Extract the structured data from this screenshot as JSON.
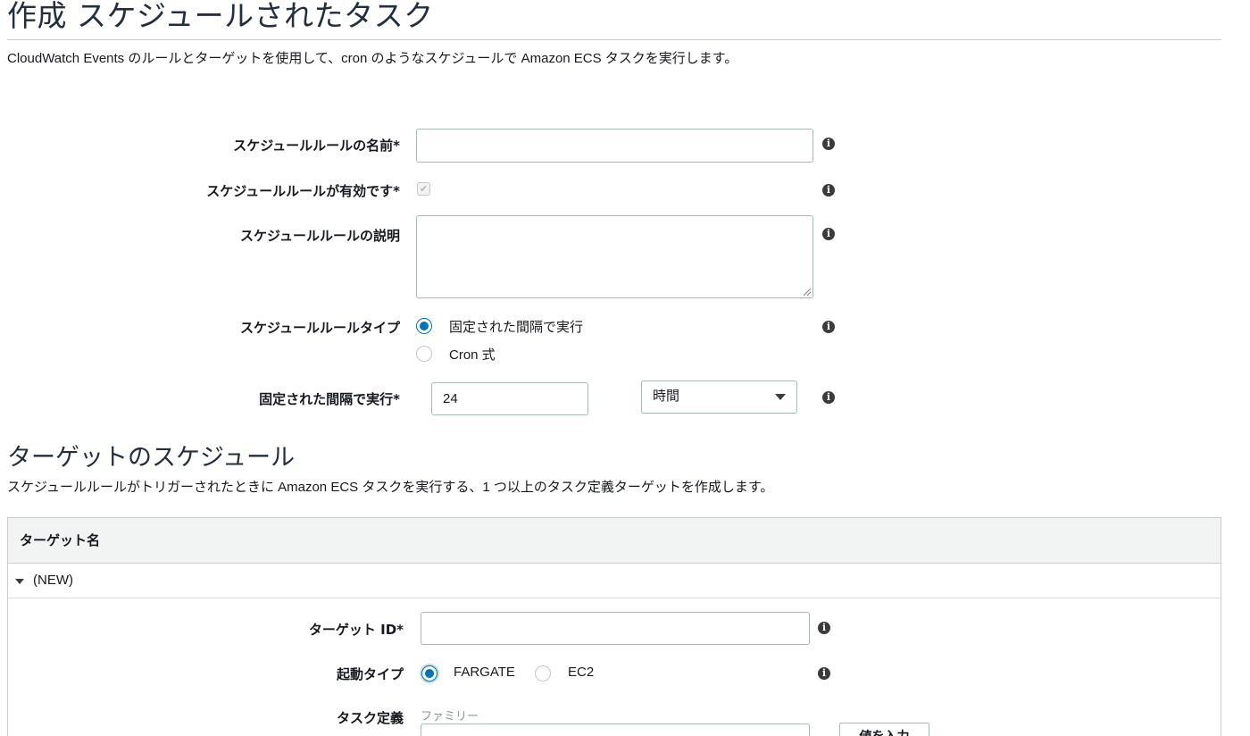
{
  "header": {
    "title": "作成 スケジュールされたタスク",
    "description": "CloudWatch Events のルールとターゲットを使用して、cron のようなスケジュールで Amazon ECS タスクを実行します。"
  },
  "rule_form": {
    "name_label": "スケジュールルールの名前*",
    "name_value": "",
    "enabled_label": "スケジュールルールが有効です*",
    "description_label": "スケジュールルールの説明",
    "description_value": "",
    "type_label": "スケジュールルールタイプ",
    "type_options": [
      "固定された間隔で実行",
      "Cron 式"
    ],
    "type_selected": "固定された間隔で実行",
    "interval_label": "固定された間隔で実行*",
    "interval_value": "24",
    "interval_unit": "時間"
  },
  "targets_section": {
    "title": "ターゲットのスケジュール",
    "description": "スケジュールルールがトリガーされたときに Amazon ECS タスクを実行する、1 つ以上のタスク定義ターゲットを作成します。",
    "table_header": "ターゲット名",
    "row_label": "(NEW)",
    "target_id_label": "ターゲット ID*",
    "target_id_value": "",
    "launch_type_label": "起動タイプ",
    "launch_type_options": [
      "FARGATE",
      "EC2"
    ],
    "launch_type_selected": "FARGATE",
    "task_def_label": "タスク定義",
    "family_label": "ファミリー",
    "enter_value_button": "値を入力"
  },
  "icons": {
    "info": "info-icon",
    "check": "check-icon"
  },
  "colors": {
    "accent": "#0073bb",
    "heading": "#232f3e",
    "panel_header_bg": "#f2f3f3"
  }
}
